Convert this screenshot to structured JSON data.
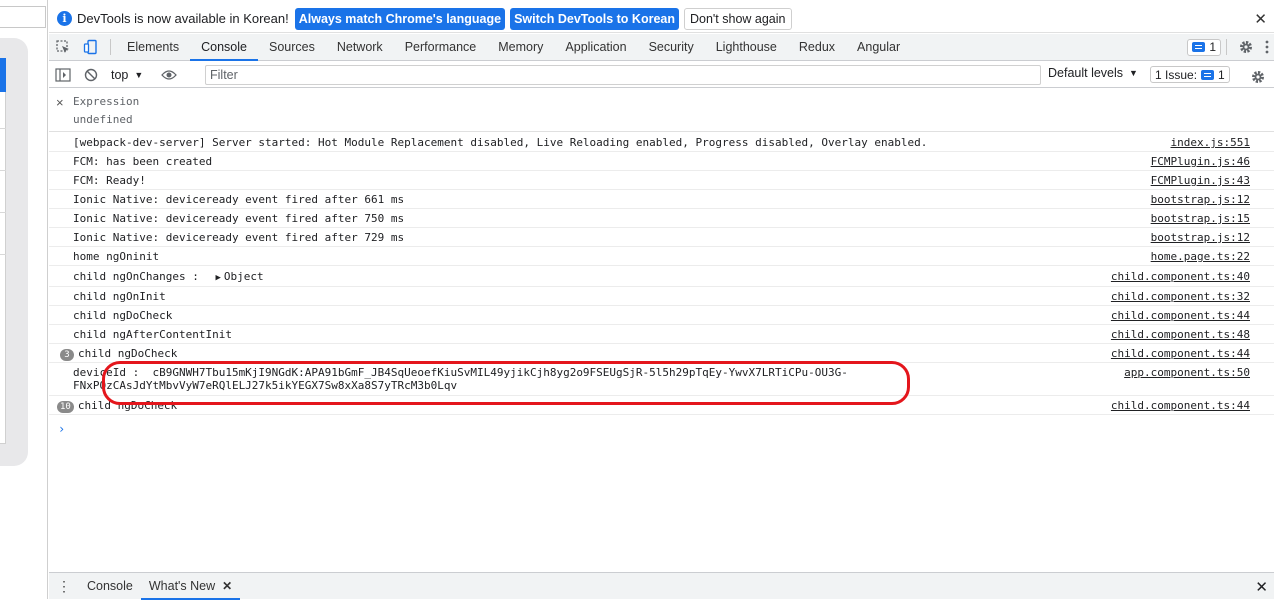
{
  "infobar": {
    "message": "DevTools is now available in Korean!",
    "match_button": "Always match Chrome's language",
    "switch_button": "Switch DevTools to Korean",
    "dismiss_button": "Don't show again",
    "close": "✕"
  },
  "tabs": [
    "Elements",
    "Console",
    "Sources",
    "Network",
    "Performance",
    "Memory",
    "Application",
    "Security",
    "Lighthouse",
    "Redux",
    "Angular"
  ],
  "active_tab": "Console",
  "tabbar_badge_count": "1",
  "toolbar": {
    "context": "top",
    "filter_placeholder": "Filter",
    "levels": "Default levels",
    "issues_label": "1 Issue:",
    "issues_count": "1"
  },
  "expression": {
    "label": "Expression",
    "value": "undefined"
  },
  "logs": [
    {
      "text": "[webpack-dev-server] Server started: Hot Module Replacement disabled, Live Reloading enabled, Progress disabled, Overlay enabled.",
      "source": "index.js:551"
    },
    {
      "text": "FCM: has been created",
      "source": "FCMPlugin.js:46"
    },
    {
      "text": "FCM: Ready!",
      "source": "FCMPlugin.js:43"
    },
    {
      "text": "Ionic Native: deviceready event fired after 661 ms",
      "source": "bootstrap.js:12"
    },
    {
      "text": "Ionic Native: deviceready event fired after 750 ms",
      "source": "bootstrap.js:15"
    },
    {
      "text": "Ionic Native: deviceready event fired after 729 ms",
      "source": "bootstrap.js:12"
    },
    {
      "text": "home ngOninit",
      "source": "home.page.ts:22"
    },
    {
      "text": "child ngOnChanges : ",
      "object": "Object",
      "source": "child.component.ts:40"
    },
    {
      "text": "child ngOnInit",
      "source": "child.component.ts:32"
    },
    {
      "text": "child ngDoCheck",
      "source": "child.component.ts:44"
    },
    {
      "text": "child ngAfterContentInit",
      "source": "child.component.ts:48"
    },
    {
      "count": "3",
      "text": "child ngDoCheck",
      "source": "child.component.ts:44"
    },
    {
      "text": "deviceId :  cB9GNWH7Tbu15mKjI9NGdK:APA91bGmF_JB4SqUeoefKiuSvMIL49yjikCjh8yg2o9FSEUgSjR-5l5h29pTqEy-YwvX7LRTiCPu-OU3G-\nFNxPQzCAsJdYtMbvVyW7eRQlELJ27k5ikYEGX7Sw8xXa8S7yTRcM3b0Lqv",
      "source": "app.component.ts:50"
    },
    {
      "count": "10",
      "text": "child ngDoCheck",
      "source": "child.component.ts:44"
    }
  ],
  "prompt": "›",
  "drawer": {
    "tabs": [
      "Console",
      "What's New"
    ],
    "close_tab": "✕",
    "close": "✕"
  },
  "colors": {
    "accent": "#1a73e8",
    "highlight": "#e4161c"
  }
}
